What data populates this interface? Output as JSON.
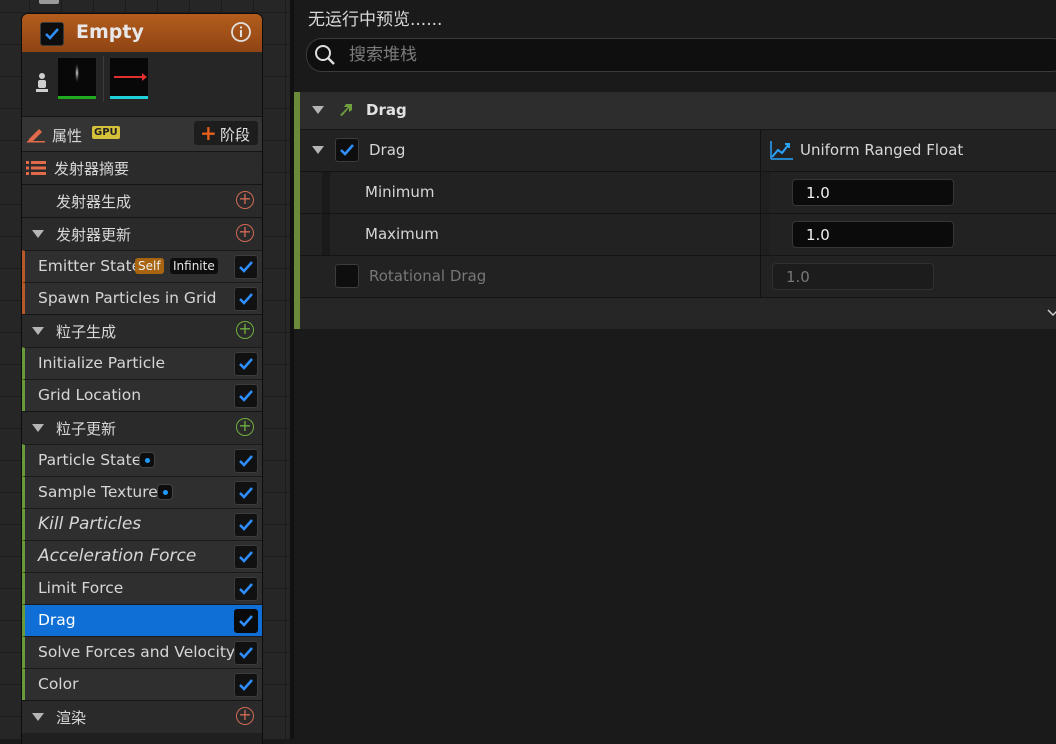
{
  "node": {
    "title": "Empty",
    "properties_label": "属性",
    "gpu_badge": "GPU",
    "stage_button": "阶段",
    "summary_label": "发射器摘要",
    "emitter_spawn": "发射器生成",
    "emitter_update": "发射器更新",
    "particle_spawn": "粒子生成",
    "particle_update": "粒子更新",
    "render": "渲染",
    "modules": {
      "emitter_state": "Emitter State",
      "self_badge": "Self",
      "infinite_badge": "Infinite",
      "spawn_grid": "Spawn Particles in Grid",
      "init_particle": "Initialize Particle",
      "grid_location": "Grid Location",
      "particle_state": "Particle State",
      "sample_texture": "Sample Texture",
      "kill_particles": "Kill Particles",
      "accel_force": "Acceleration Force",
      "limit_force": "Limit Force",
      "drag": "Drag",
      "solve_forces": "Solve Forces and Velocity",
      "color": "Color"
    }
  },
  "right": {
    "preview_text": "无运行中预览......",
    "search_placeholder": "搜索堆栈",
    "section_title": "Drag",
    "drag_label": "Drag",
    "drag_type": "Uniform Ranged Float",
    "minimum_label": "Minimum",
    "minimum_value": "1.0",
    "maximum_label": "Maximum",
    "maximum_value": "1.0",
    "rot_drag_label": "Rotational Drag",
    "rot_drag_value": "1.0"
  },
  "colors": {
    "accent_blue": "#0f6fd6",
    "header_orange": "#b35d1c",
    "module_green": "#6a9a3a"
  }
}
